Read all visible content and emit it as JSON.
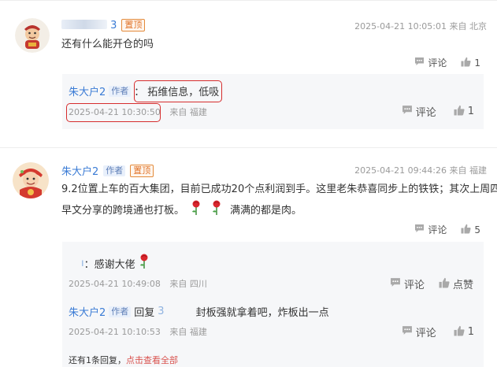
{
  "comments": [
    {
      "user": {
        "name": "3",
        "blurred_prefix": "​​​"
      },
      "top_badge": "置顶",
      "time": "2025-04-21 10:05:01",
      "source": "来自 北京",
      "text": "还有什么能开仓的吗",
      "actions": {
        "comment_label": "评论",
        "like_count": "1"
      },
      "replies": [
        {
          "user": {
            "name": "朱大户2",
            "badge": "作者"
          },
          "colon": "：",
          "text": "拓维信息，低吸",
          "time": "2025-04-21 10:30:50",
          "source": "来自 福建",
          "actions": {
            "comment_label": "评论",
            "like_count": "1"
          }
        }
      ]
    },
    {
      "user": {
        "name": "朱大户2",
        "badge": "作者"
      },
      "top_badge": "置顶",
      "time": "2025-04-21 09:44:26",
      "source": "来自 福建",
      "text_line1": "9.2位置上车的百大集团，目前已成功20个点利润到手。这里老朱恭喜同步上的铁铁；其次上周四",
      "text_line2": "早文分享的跨境通也打板。",
      "text_line2_tail": "满满的都是肉。",
      "actions": {
        "comment_label": "评论",
        "like_count": "5"
      },
      "replies": [
        {
          "user": {
            "name": "ı"
          },
          "colon": "：",
          "text": "感谢大佬",
          "time": "2025-04-21 10:49:08",
          "source": "来自 四川",
          "actions": {
            "comment_label": "评论",
            "like_label": "点赞"
          }
        },
        {
          "user": {
            "name": "朱大户2",
            "badge": "作者"
          },
          "reply_word": "回复",
          "reply_to": "3",
          "text": "封板强就拿着吧，炸板出一点",
          "time": "2025-04-21 10:10:53",
          "source": "来自 福建",
          "actions": {
            "comment_label": "评论",
            "like_count": "1"
          }
        }
      ],
      "more_replies": {
        "prefix": "还有1条回复，",
        "link": "点击查看全部"
      }
    }
  ],
  "colors": {
    "link_blue": "#3a7bd5",
    "top_badge": "#e0742a",
    "highlight_red": "#d62d2d",
    "view_all_red": "#d9534f"
  },
  "icons": [
    "comment-icon",
    "thumbs-up-icon",
    "rose-icon"
  ]
}
